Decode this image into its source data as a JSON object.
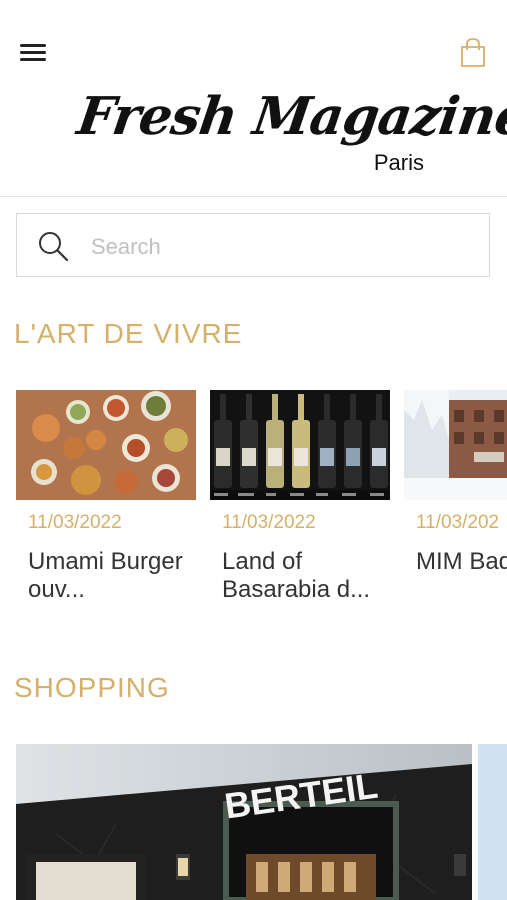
{
  "header": {
    "logo_main": "Fresh Magazine",
    "logo_sub": "Paris",
    "menu_icon": "hamburger-menu-icon",
    "cart_icon": "shopping-bag-icon",
    "accent_color": "#d4b06a"
  },
  "search": {
    "placeholder": "Search"
  },
  "sections": [
    {
      "title": "L'ART DE VIVRE",
      "cards": [
        {
          "date": "11/03/2022",
          "title": "Umami Burger ouv..."
        },
        {
          "date": "11/03/2022",
          "title": "Land of Basarabia d..."
        },
        {
          "date": "11/03/202",
          "title": "MIM Baqueira"
        }
      ]
    },
    {
      "title": "SHOPPING",
      "cards": [
        {
          "sign": "BERTEIL"
        }
      ]
    }
  ]
}
